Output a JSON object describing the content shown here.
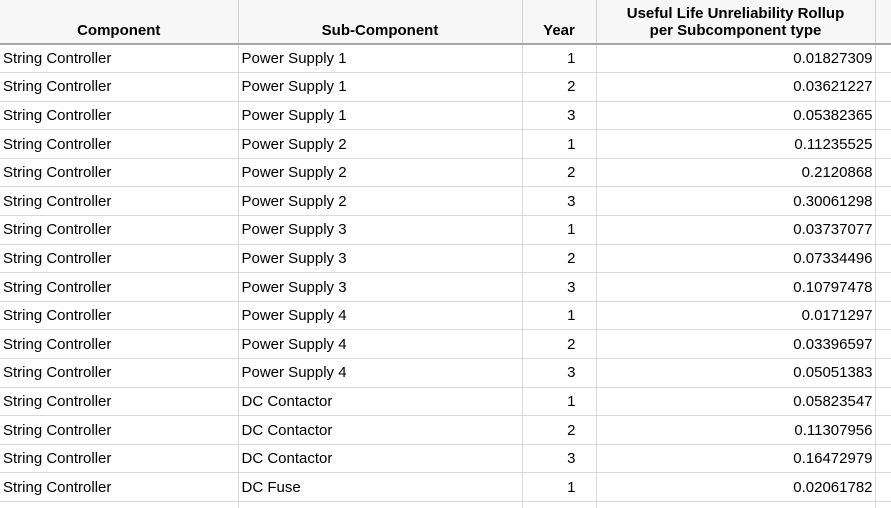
{
  "table": {
    "columns": [
      {
        "key": "component",
        "label": "Component",
        "align": "left"
      },
      {
        "key": "subcomponent",
        "label": "Sub-Component",
        "align": "left"
      },
      {
        "key": "year",
        "label": "Year",
        "align": "right"
      },
      {
        "key": "value",
        "label": "Useful Life Unreliability Rollup per Subcomponent type",
        "label_line1": "Useful Life Unreliability Rollup",
        "label_line2": "per Subcomponent type",
        "align": "right"
      }
    ],
    "rows": [
      {
        "component": "String Controller",
        "subcomponent": "Power Supply 1",
        "year": "1",
        "value": "0.01827309"
      },
      {
        "component": "String Controller",
        "subcomponent": "Power Supply 1",
        "year": "2",
        "value": "0.03621227"
      },
      {
        "component": "String Controller",
        "subcomponent": "Power Supply 1",
        "year": "3",
        "value": "0.05382365"
      },
      {
        "component": "String Controller",
        "subcomponent": "Power Supply 2",
        "year": "1",
        "value": "0.11235525"
      },
      {
        "component": "String Controller",
        "subcomponent": "Power Supply 2",
        "year": "2",
        "value": "0.2120868"
      },
      {
        "component": "String Controller",
        "subcomponent": "Power Supply 2",
        "year": "3",
        "value": "0.30061298"
      },
      {
        "component": "String Controller",
        "subcomponent": "Power Supply 3",
        "year": "1",
        "value": "0.03737077"
      },
      {
        "component": "String Controller",
        "subcomponent": "Power Supply 3",
        "year": "2",
        "value": "0.07334496"
      },
      {
        "component": "String Controller",
        "subcomponent": "Power Supply 3",
        "year": "3",
        "value": "0.10797478"
      },
      {
        "component": "String Controller",
        "subcomponent": "Power Supply 4",
        "year": "1",
        "value": "0.0171297"
      },
      {
        "component": "String Controller",
        "subcomponent": "Power Supply 4",
        "year": "2",
        "value": "0.03396597"
      },
      {
        "component": "String Controller",
        "subcomponent": "Power Supply 4",
        "year": "3",
        "value": "0.05051383"
      },
      {
        "component": "String Controller",
        "subcomponent": "DC Contactor",
        "year": "1",
        "value": "0.05823547"
      },
      {
        "component": "String Controller",
        "subcomponent": "DC Contactor",
        "year": "2",
        "value": "0.11307956"
      },
      {
        "component": "String Controller",
        "subcomponent": "DC Contactor",
        "year": "3",
        "value": "0.16472979"
      },
      {
        "component": "String Controller",
        "subcomponent": "DC Fuse",
        "year": "1",
        "value": "0.02061782"
      }
    ]
  },
  "colors": {
    "header_background": "#f7f7f7",
    "header_rule": "#a6a6a6",
    "grid_line": "#d9d9d9",
    "text": "#000000",
    "cell_background": "#ffffff"
  }
}
